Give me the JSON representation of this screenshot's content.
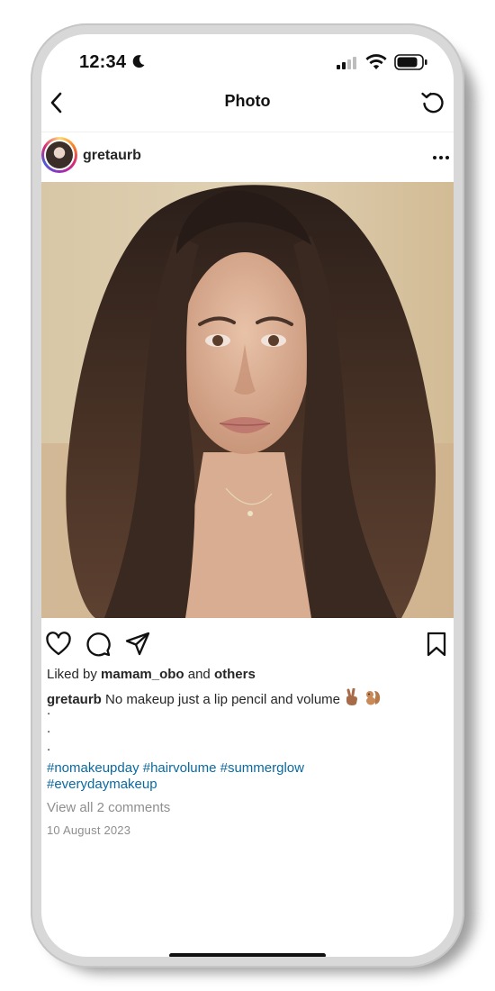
{
  "status_bar": {
    "time": "12:34"
  },
  "nav": {
    "title": "Photo"
  },
  "post": {
    "username": "gretaurb",
    "liked_prefix": "Liked by",
    "liked_user": "mamam_obo",
    "liked_and": "and",
    "liked_others": "others",
    "caption_user": "gretaurb",
    "caption_text": "No makeup just a lip pencil and volume",
    "caption_emojis": [
      "victory-hand-emoji",
      "squirrel-emoji"
    ],
    "caption_dots": [
      ".",
      ".",
      "."
    ],
    "hashtags_line1": "#nomakeupday #hairvolume #summerglow",
    "hashtags_line2": "#everydaymakeup",
    "view_comments": "View all 2 comments",
    "date": "10 August 2023"
  },
  "icons": {
    "back": "chevron-left-icon",
    "refresh": "refresh-icon",
    "more": "more-horizontal-icon",
    "like": "heart-icon",
    "comment": "comment-icon",
    "share": "send-icon",
    "save": "bookmark-icon"
  },
  "colors": {
    "hashtag": "#0a6aa1",
    "muted": "#8e8e8e",
    "text": "#262626"
  }
}
